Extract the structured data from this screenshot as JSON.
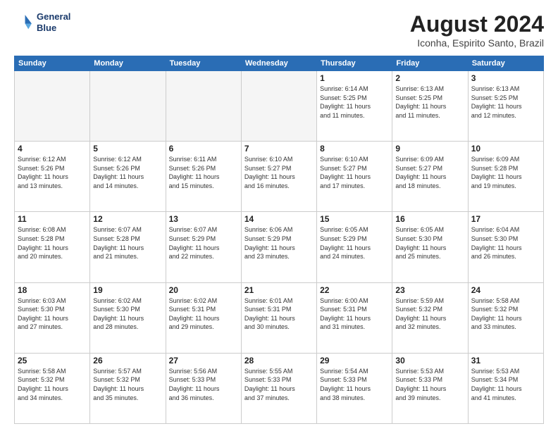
{
  "header": {
    "logo_line1": "General",
    "logo_line2": "Blue",
    "month": "August 2024",
    "location": "Iconha, Espirito Santo, Brazil"
  },
  "weekdays": [
    "Sunday",
    "Monday",
    "Tuesday",
    "Wednesday",
    "Thursday",
    "Friday",
    "Saturday"
  ],
  "weeks": [
    [
      {
        "day": "",
        "info": "",
        "empty": true
      },
      {
        "day": "",
        "info": "",
        "empty": true
      },
      {
        "day": "",
        "info": "",
        "empty": true
      },
      {
        "day": "",
        "info": "",
        "empty": true
      },
      {
        "day": "1",
        "info": "Sunrise: 6:14 AM\nSunset: 5:25 PM\nDaylight: 11 hours\nand 11 minutes."
      },
      {
        "day": "2",
        "info": "Sunrise: 6:13 AM\nSunset: 5:25 PM\nDaylight: 11 hours\nand 11 minutes."
      },
      {
        "day": "3",
        "info": "Sunrise: 6:13 AM\nSunset: 5:25 PM\nDaylight: 11 hours\nand 12 minutes."
      }
    ],
    [
      {
        "day": "4",
        "info": "Sunrise: 6:12 AM\nSunset: 5:26 PM\nDaylight: 11 hours\nand 13 minutes."
      },
      {
        "day": "5",
        "info": "Sunrise: 6:12 AM\nSunset: 5:26 PM\nDaylight: 11 hours\nand 14 minutes."
      },
      {
        "day": "6",
        "info": "Sunrise: 6:11 AM\nSunset: 5:26 PM\nDaylight: 11 hours\nand 15 minutes."
      },
      {
        "day": "7",
        "info": "Sunrise: 6:10 AM\nSunset: 5:27 PM\nDaylight: 11 hours\nand 16 minutes."
      },
      {
        "day": "8",
        "info": "Sunrise: 6:10 AM\nSunset: 5:27 PM\nDaylight: 11 hours\nand 17 minutes."
      },
      {
        "day": "9",
        "info": "Sunrise: 6:09 AM\nSunset: 5:27 PM\nDaylight: 11 hours\nand 18 minutes."
      },
      {
        "day": "10",
        "info": "Sunrise: 6:09 AM\nSunset: 5:28 PM\nDaylight: 11 hours\nand 19 minutes."
      }
    ],
    [
      {
        "day": "11",
        "info": "Sunrise: 6:08 AM\nSunset: 5:28 PM\nDaylight: 11 hours\nand 20 minutes."
      },
      {
        "day": "12",
        "info": "Sunrise: 6:07 AM\nSunset: 5:28 PM\nDaylight: 11 hours\nand 21 minutes."
      },
      {
        "day": "13",
        "info": "Sunrise: 6:07 AM\nSunset: 5:29 PM\nDaylight: 11 hours\nand 22 minutes."
      },
      {
        "day": "14",
        "info": "Sunrise: 6:06 AM\nSunset: 5:29 PM\nDaylight: 11 hours\nand 23 minutes."
      },
      {
        "day": "15",
        "info": "Sunrise: 6:05 AM\nSunset: 5:29 PM\nDaylight: 11 hours\nand 24 minutes."
      },
      {
        "day": "16",
        "info": "Sunrise: 6:05 AM\nSunset: 5:30 PM\nDaylight: 11 hours\nand 25 minutes."
      },
      {
        "day": "17",
        "info": "Sunrise: 6:04 AM\nSunset: 5:30 PM\nDaylight: 11 hours\nand 26 minutes."
      }
    ],
    [
      {
        "day": "18",
        "info": "Sunrise: 6:03 AM\nSunset: 5:30 PM\nDaylight: 11 hours\nand 27 minutes."
      },
      {
        "day": "19",
        "info": "Sunrise: 6:02 AM\nSunset: 5:30 PM\nDaylight: 11 hours\nand 28 minutes."
      },
      {
        "day": "20",
        "info": "Sunrise: 6:02 AM\nSunset: 5:31 PM\nDaylight: 11 hours\nand 29 minutes."
      },
      {
        "day": "21",
        "info": "Sunrise: 6:01 AM\nSunset: 5:31 PM\nDaylight: 11 hours\nand 30 minutes."
      },
      {
        "day": "22",
        "info": "Sunrise: 6:00 AM\nSunset: 5:31 PM\nDaylight: 11 hours\nand 31 minutes."
      },
      {
        "day": "23",
        "info": "Sunrise: 5:59 AM\nSunset: 5:32 PM\nDaylight: 11 hours\nand 32 minutes."
      },
      {
        "day": "24",
        "info": "Sunrise: 5:58 AM\nSunset: 5:32 PM\nDaylight: 11 hours\nand 33 minutes."
      }
    ],
    [
      {
        "day": "25",
        "info": "Sunrise: 5:58 AM\nSunset: 5:32 PM\nDaylight: 11 hours\nand 34 minutes."
      },
      {
        "day": "26",
        "info": "Sunrise: 5:57 AM\nSunset: 5:32 PM\nDaylight: 11 hours\nand 35 minutes."
      },
      {
        "day": "27",
        "info": "Sunrise: 5:56 AM\nSunset: 5:33 PM\nDaylight: 11 hours\nand 36 minutes."
      },
      {
        "day": "28",
        "info": "Sunrise: 5:55 AM\nSunset: 5:33 PM\nDaylight: 11 hours\nand 37 minutes."
      },
      {
        "day": "29",
        "info": "Sunrise: 5:54 AM\nSunset: 5:33 PM\nDaylight: 11 hours\nand 38 minutes."
      },
      {
        "day": "30",
        "info": "Sunrise: 5:53 AM\nSunset: 5:33 PM\nDaylight: 11 hours\nand 39 minutes."
      },
      {
        "day": "31",
        "info": "Sunrise: 5:53 AM\nSunset: 5:34 PM\nDaylight: 11 hours\nand 41 minutes."
      }
    ]
  ]
}
